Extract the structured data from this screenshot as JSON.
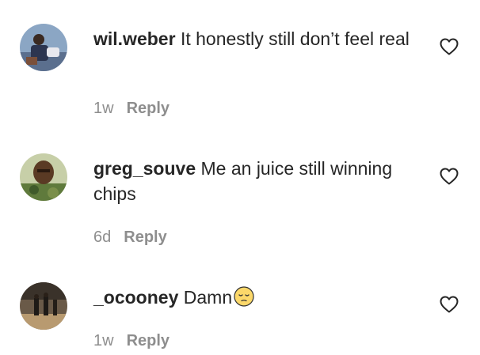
{
  "comments": [
    {
      "username": "wil.weber",
      "text": "It honestly still don’t feel real",
      "time": "1w",
      "reply_label": "Reply",
      "avatar_icon": "user-avatar-photo",
      "like_icon": "heart-outline-icon"
    },
    {
      "username": "greg_souve",
      "text": "Me an juice still winning chips",
      "time": "6d",
      "reply_label": "Reply",
      "avatar_icon": "user-avatar-photo",
      "like_icon": "heart-outline-icon"
    },
    {
      "username": "_ocooney",
      "text": "Damn",
      "emoji": "pensive-face-emoji",
      "time": "1w",
      "reply_label": "Reply",
      "avatar_icon": "user-avatar-photo",
      "like_icon": "heart-outline-icon"
    }
  ],
  "colors": {
    "text": "#262626",
    "meta": "#8e8e8e"
  }
}
